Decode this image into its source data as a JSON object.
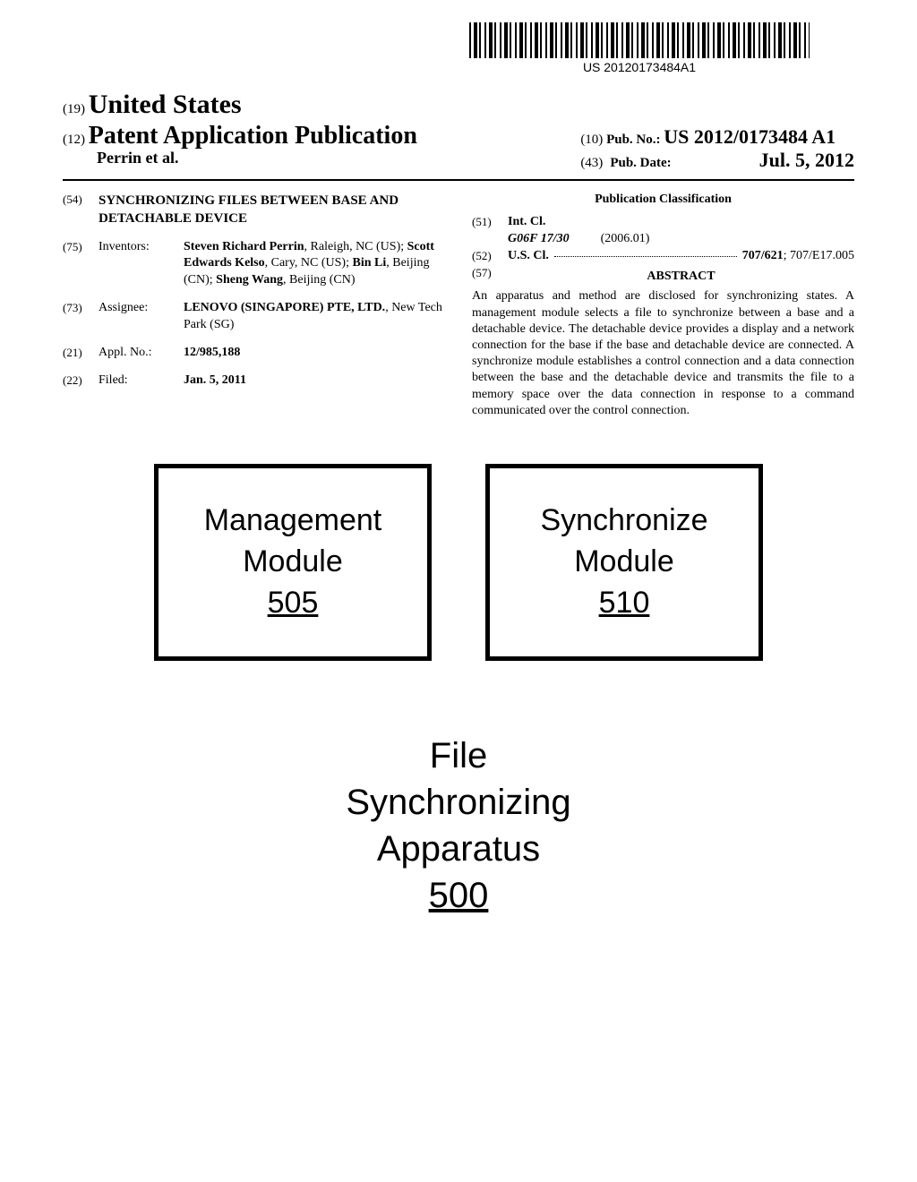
{
  "barcode_text": "US 20120173484A1",
  "header": {
    "code19": "(19)",
    "country": "United States",
    "code12": "(12)",
    "doc_type": "Patent Application Publication",
    "authors_short": "Perrin et al.",
    "code10": "(10)",
    "pub_no_label": "Pub. No.:",
    "pub_no": "US 2012/0173484 A1",
    "code43": "(43)",
    "pub_date_label": "Pub. Date:",
    "pub_date": "Jul. 5, 2012"
  },
  "left_col": {
    "title_code": "(54)",
    "title": "SYNCHRONIZING FILES BETWEEN BASE AND DETACHABLE DEVICE",
    "inventors_code": "(75)",
    "inventors_label": "Inventors:",
    "inventors_html": "Steven Richard Perrin, Raleigh, NC (US); Scott Edwards Kelso, Cary, NC (US); Bin Li, Beijing (CN); Sheng Wang, Beijing (CN)",
    "inv1_name": "Steven Richard Perrin",
    "inv1_loc": ", Raleigh, NC (US); ",
    "inv2_name": "Scott Edwards Kelso",
    "inv2_loc": ", Cary, NC (US); ",
    "inv3_name": "Bin Li",
    "inv3_loc": ", Beijing (CN); ",
    "inv4_name": "Sheng Wang",
    "inv4_loc": ", Beijing (CN)",
    "assignee_code": "(73)",
    "assignee_label": "Assignee:",
    "assignee_name": "LENOVO (SINGAPORE) PTE, LTD.",
    "assignee_loc": ", New Tech Park (SG)",
    "appl_code": "(21)",
    "appl_label": "Appl. No.:",
    "appl_no": "12/985,188",
    "filed_code": "(22)",
    "filed_label": "Filed:",
    "filed_date": "Jan. 5, 2011"
  },
  "right_col": {
    "pub_class_title": "Publication Classification",
    "int_cl_code": "(51)",
    "int_cl_label": "Int. Cl.",
    "int_cl_class": "G06F 17/30",
    "int_cl_year": "(2006.01)",
    "us_cl_code": "(52)",
    "us_cl_label": "U.S. Cl.",
    "us_cl_main": "707/621",
    "us_cl_sub": "; 707/E17.005",
    "abstract_code": "(57)",
    "abstract_label": "ABSTRACT",
    "abstract_text": "An apparatus and method are disclosed for synchronizing states. A management module selects a file to synchronize between a base and a detachable device. The detachable device provides a display and a network connection for the base if the base and detachable device are connected. A synchronize module establishes a control connection and a data connection between the base and the detachable device and transmits the file to a memory space over the data connection in response to a command communicated over the control connection."
  },
  "figure": {
    "box1_line1": "Management",
    "box1_line2": "Module",
    "box1_num": "505",
    "box2_line1": "Synchronize",
    "box2_line2": "Module",
    "box2_num": "510",
    "apparatus_line1": "File",
    "apparatus_line2": "Synchronizing",
    "apparatus_line3": "Apparatus",
    "apparatus_num": "500"
  }
}
